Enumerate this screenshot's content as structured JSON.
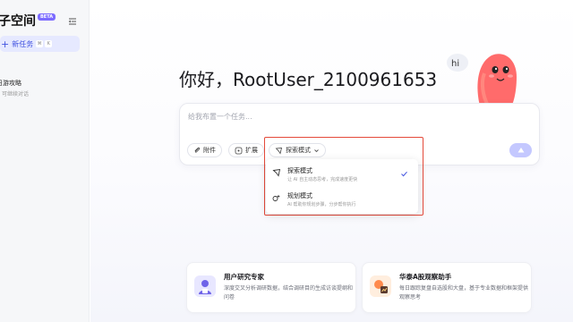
{
  "sidebar": {
    "brand": "子空间",
    "beta_badge": "BETA",
    "new_task_label": "新任务",
    "new_task_kbd_1": "⌘",
    "new_task_kbd_2": "K",
    "history": [
      {
        "title": "日游攻略",
        "subtitle": "可继续对话"
      }
    ]
  },
  "main": {
    "greeting": "你好，RootUser_2100961653",
    "mascot_bubble": "hi",
    "composer": {
      "placeholder": "给我布置一个任务...",
      "attach_label": "附件",
      "extend_label": "扩展",
      "mode_label": "探索模式"
    },
    "mode_menu": {
      "options": [
        {
          "title": "探索模式",
          "desc": "让 AI 自主动态思考，完成速度更快",
          "selected": true
        },
        {
          "title": "规划模式",
          "desc": "AI 帮助你规划步骤，分步帮你执行",
          "selected": false
        }
      ]
    },
    "cards": [
      {
        "title": "用户研究专家",
        "desc": "深度交叉分析调研数据，结合调研目的生成访谈提纲和问卷"
      },
      {
        "title": "华泰A股观察助手",
        "desc": "每日跟踪复盘自选股和大盘，基于专业数据和框架提供观察思考"
      }
    ]
  },
  "colors": {
    "accent": "#4253e0",
    "send_button": "#c4c8ff",
    "highlight_border": "#e44a3a",
    "mascot": "#ff6b6b"
  }
}
